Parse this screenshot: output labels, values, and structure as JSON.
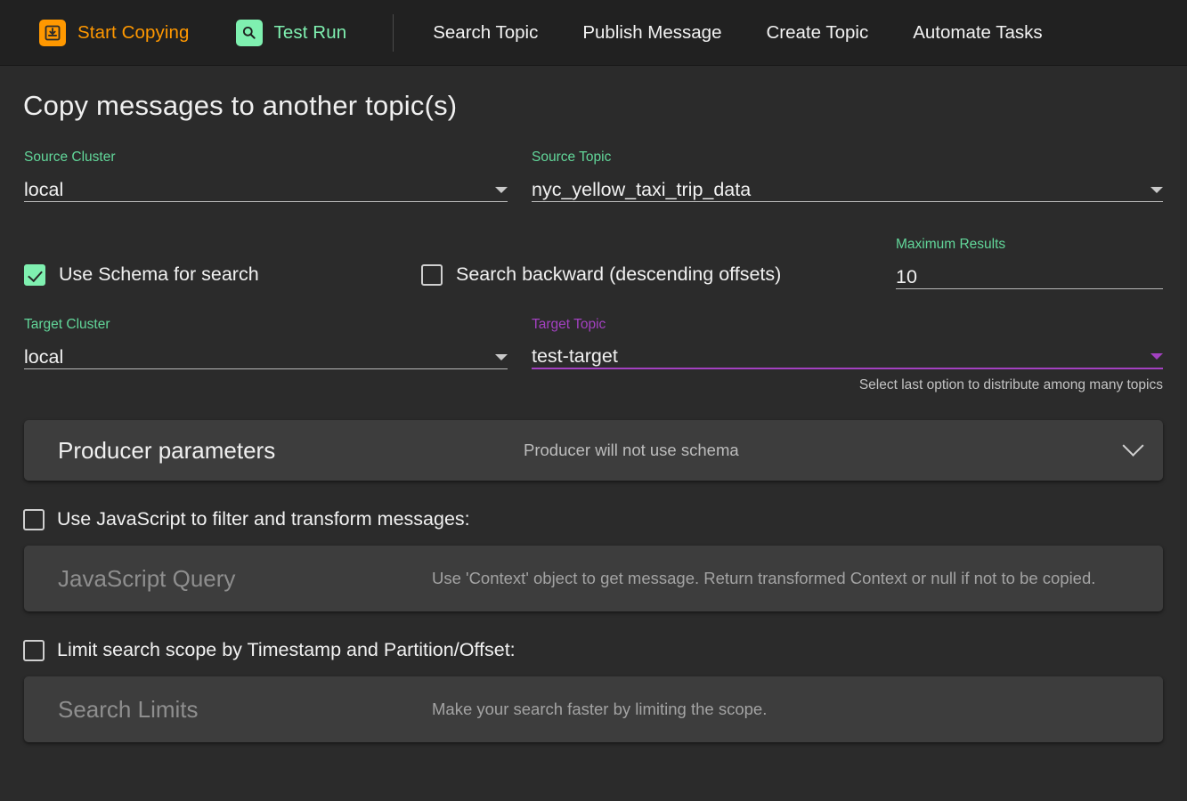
{
  "topbar": {
    "actions": [
      {
        "label": "Start Copying",
        "icon": "download-to-tray-icon",
        "color": "#ff9800"
      },
      {
        "label": "Test Run",
        "icon": "magnifier-icon",
        "color": "#7ff0b0"
      }
    ],
    "links": [
      {
        "label": "Search Topic"
      },
      {
        "label": "Publish Message"
      },
      {
        "label": "Create Topic"
      },
      {
        "label": "Automate Tasks"
      }
    ]
  },
  "page": {
    "title": "Copy messages to another topic(s)"
  },
  "form": {
    "source_cluster": {
      "label": "Source Cluster",
      "value": "local"
    },
    "source_topic": {
      "label": "Source Topic",
      "value": "nyc_yellow_taxi_trip_data"
    },
    "use_schema": {
      "label": "Use Schema for search",
      "checked": true
    },
    "search_backward": {
      "label": "Search backward (descending offsets)",
      "checked": false
    },
    "maximum_results": {
      "label": "Maximum Results",
      "value": "10"
    },
    "target_cluster": {
      "label": "Target Cluster",
      "value": "local"
    },
    "target_topic": {
      "label": "Target Topic",
      "value": "test-target",
      "focused": true
    },
    "target_topic_hint": "Select last option to distribute among many topics"
  },
  "panels": {
    "producer": {
      "title": "Producer parameters",
      "description": "Producer will not use schema",
      "expanded": false
    },
    "javascript": {
      "checkbox_label": "Use JavaScript to filter and transform messages:",
      "checked": false,
      "title": "JavaScript Query",
      "description": "Use 'Context' object to get message. Return transformed Context or null if not to be copied."
    },
    "search_limits": {
      "checkbox_label": "Limit search scope by Timestamp and Partition/Offset:",
      "checked": false,
      "title": "Search Limits",
      "description": "Make your search faster by limiting the scope."
    }
  },
  "colors": {
    "accent_green": "#7ff0b0",
    "accent_orange": "#ff9800",
    "accent_purple": "#a341c1",
    "label_green": "#62d79a",
    "background": "#2b2b2b",
    "topbar_background": "#212121",
    "panel_background": "#3d3d3d"
  }
}
